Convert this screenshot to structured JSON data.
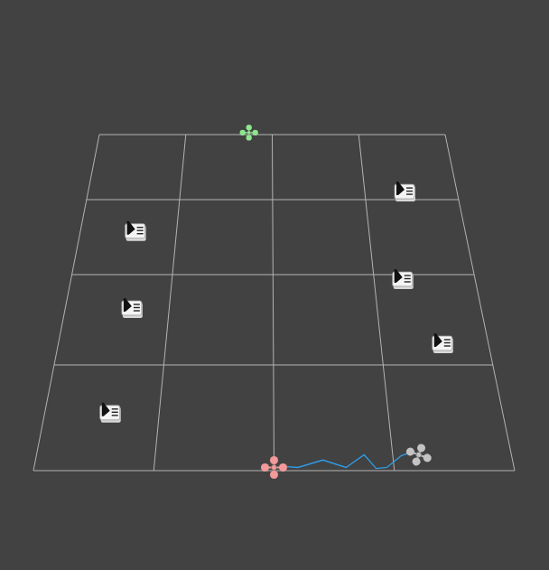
{
  "scene": {
    "grid": {
      "rows": 4,
      "cols": 4
    }
  },
  "obstacles": [
    {
      "u": 3.43,
      "v": 0.89
    },
    {
      "u": 0.57,
      "v": 1.43
    },
    {
      "u": 3.28,
      "v": 2.06
    },
    {
      "u": 0.64,
      "v": 2.38
    },
    {
      "u": 3.57,
      "v": 2.77
    },
    {
      "u": 0.57,
      "v": 3.46
    }
  ],
  "drones": [
    {
      "role": "goal",
      "u": 1.73,
      "v": -0.03,
      "color": "#8ee68e"
    },
    {
      "role": "start",
      "u": 2.0,
      "v": 3.97,
      "color": "#f29a9a"
    },
    {
      "role": "current",
      "u": 3.22,
      "v": 3.85,
      "color": "#c4c4c4"
    }
  ],
  "path": {
    "color": "#2f9de8",
    "u": [
      2.08,
      2.2,
      2.41,
      2.6,
      2.76,
      2.85,
      2.94,
      3.07,
      3.17
    ],
    "v": [
      3.96,
      3.97,
      3.9,
      3.97,
      3.85,
      3.98,
      3.97,
      3.86,
      3.82
    ]
  }
}
